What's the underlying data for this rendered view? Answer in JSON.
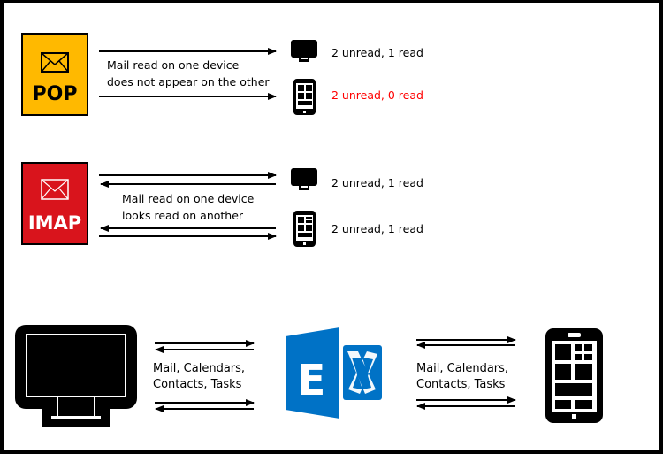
{
  "pop": {
    "label": "POP",
    "color": "#FFB900",
    "caption_line1": "Mail read on one device",
    "caption_line2": "does not appear on the other",
    "desktop_status": "2 unread, 1 read",
    "phone_status": "2 unread, 0 read",
    "phone_status_color": "#FF0000"
  },
  "imap": {
    "label": "IMAP",
    "color": "#D9141C",
    "caption_line1": "Mail read on one device",
    "caption_line2": "looks read on another",
    "desktop_status": "2 unread, 1 read",
    "phone_status": "2 unread, 1 read"
  },
  "exchange": {
    "color": "#0072C6",
    "logo_letter": "E",
    "left_caption_line1": "Mail, Calendars,",
    "left_caption_line2": "Contacts, Tasks",
    "right_caption_line1": "Mail, Calendars,",
    "right_caption_line2": "Contacts, Tasks"
  },
  "icons": [
    "envelope-icon",
    "monitor-icon",
    "phone-icon",
    "exchange-logo"
  ]
}
